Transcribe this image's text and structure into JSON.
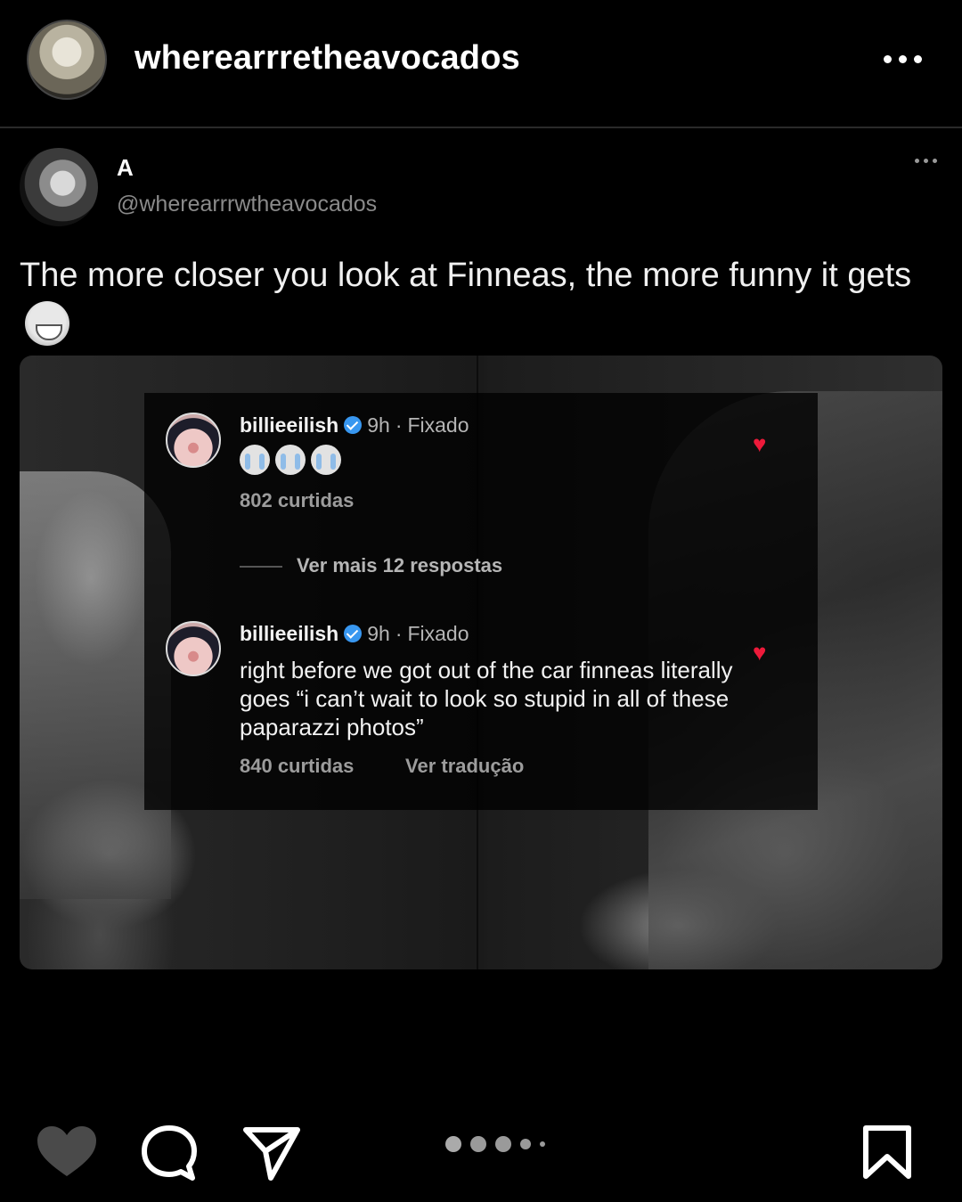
{
  "post": {
    "username": "wherearrretheavocados"
  },
  "tweet": {
    "display_name": "A",
    "handle": "@wherearrrwtheavocados",
    "text": "The more closer you look at Finneas, the more funny it gets"
  },
  "comments": [
    {
      "username": "billieeilish",
      "time": "9h",
      "pinned": "Fixado",
      "emojis": [
        "crying-face",
        "crying-face",
        "crying-face"
      ],
      "likes": "802 curtidas",
      "replies": "Ver mais 12 respostas"
    },
    {
      "username": "billieeilish",
      "time": "9h",
      "pinned": "Fixado",
      "body": "right before we got out of the car finneas literally goes “i can’t wait to look so stupid in all of these paparazzi photos”",
      "likes": "840 curtidas",
      "translate": "Ver tradução"
    }
  ],
  "carousel": {
    "count": 5,
    "active_index": 0
  },
  "colors": {
    "heart": "#ed1a3a",
    "verified": "#3897f0",
    "background": "#000000"
  }
}
